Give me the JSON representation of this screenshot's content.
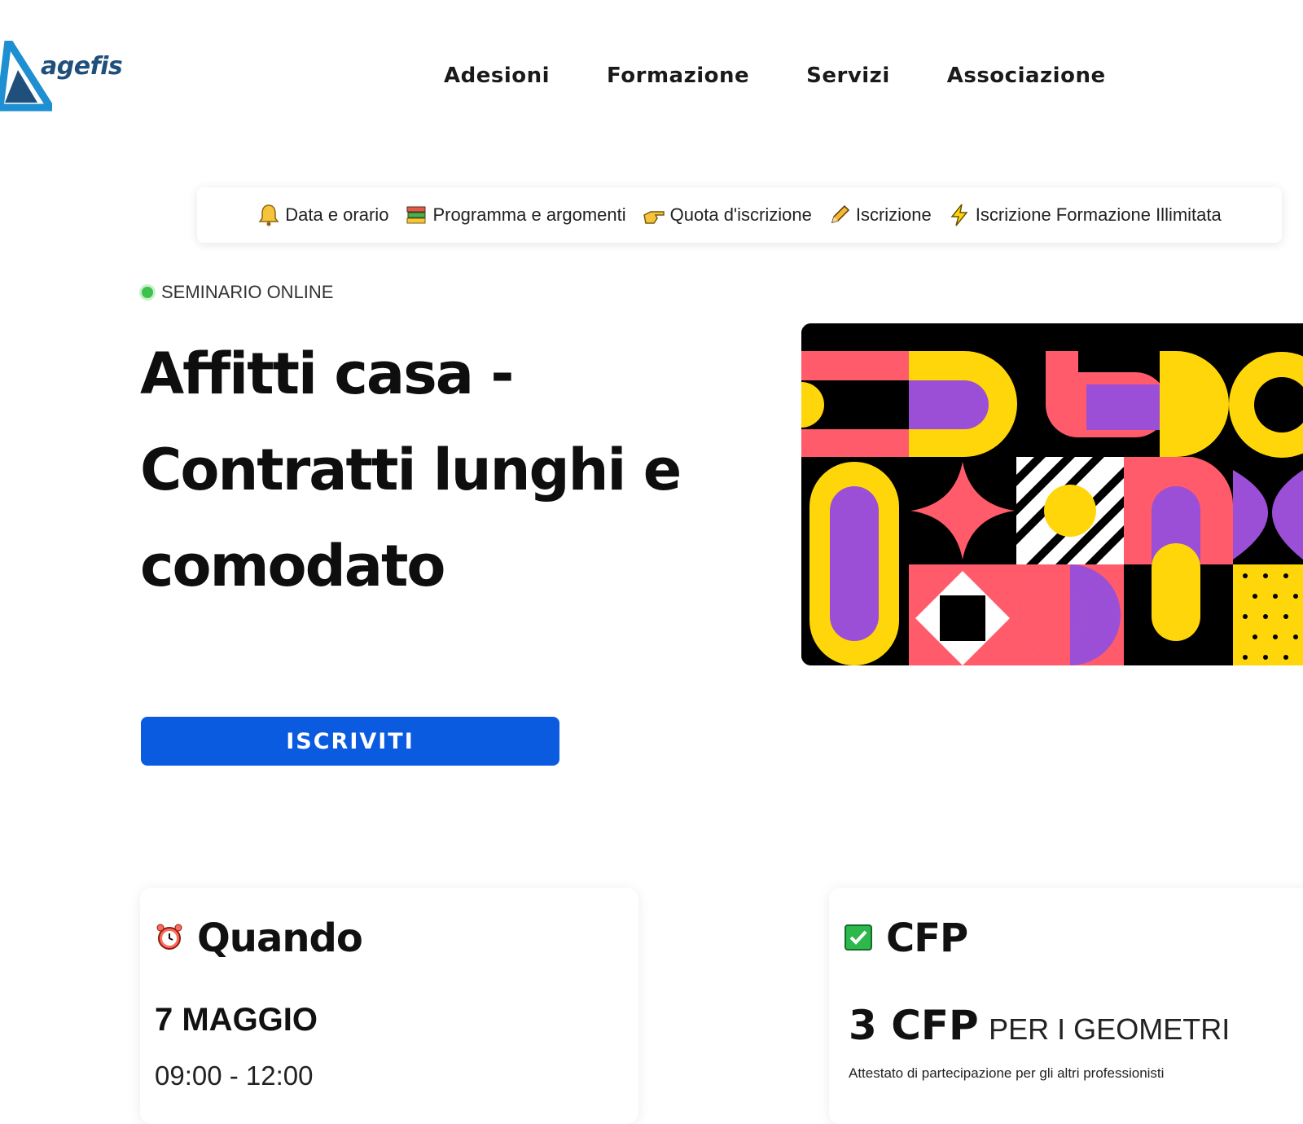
{
  "logo": {
    "text": "agefis"
  },
  "nav": {
    "items": [
      "Adesioni",
      "Formazione",
      "Servizi",
      "Associazione"
    ]
  },
  "anchor_bar": {
    "items": [
      {
        "label": "Data e orario",
        "icon": "bell-icon"
      },
      {
        "label": "Programma e argomenti",
        "icon": "books-icon"
      },
      {
        "label": "Quota d'iscrizione",
        "icon": "pointing-hand-icon"
      },
      {
        "label": "Iscrizione",
        "icon": "pencil-icon"
      },
      {
        "label": "Iscrizione Formazione Illimitata",
        "icon": "lightning-icon"
      }
    ]
  },
  "badge": {
    "label": "SEMINARIO ONLINE",
    "color": "#3cc24a"
  },
  "title": {
    "line1": "Affitti casa -",
    "line2": "Contratti lunghi e",
    "line3": "comodato"
  },
  "cta": {
    "label": "ISCRIVITI",
    "color": "#0a5be0"
  },
  "quando": {
    "heading": "Quando",
    "icon": "alarm-clock-icon",
    "date": "7 MAGGIO",
    "time": "09:00 - 12:00"
  },
  "cfp": {
    "heading": "CFP",
    "icon": "check-box-icon",
    "big": "3 CFP",
    "small": "PER I GEOMETRI",
    "note": "Attestato di partecipazione per gli altri professionisti"
  },
  "colors": {
    "hero_red": "#ff5b6b",
    "hero_yellow": "#ffd60a",
    "hero_purple": "#9b4fd6",
    "hero_black": "#000000"
  }
}
